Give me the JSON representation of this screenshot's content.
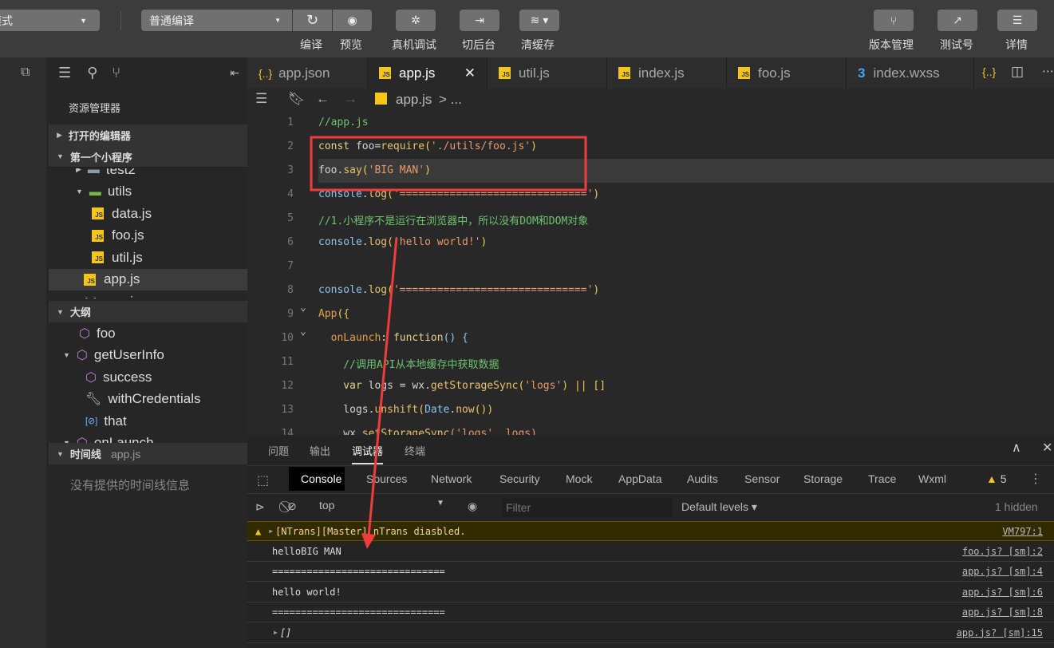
{
  "toolbar": {
    "mode_select": "模式",
    "compile_select": "普通编译",
    "buttons": {
      "compile": "编译",
      "preview": "预览",
      "remote_debug": "真机调试",
      "background": "切后台",
      "clear_cache": "清缓存",
      "version": "版本管理",
      "test_account": "测试号",
      "details": "详情"
    }
  },
  "explorer": {
    "title": "资源管理器",
    "open_editors": "打开的编辑器",
    "project": "第一个小程序",
    "files": [
      {
        "name": "test2",
        "icon": "folder",
        "indent": 1
      },
      {
        "name": "utils",
        "icon": "folder-green",
        "indent": 1
      },
      {
        "name": "data.js",
        "icon": "js",
        "indent": 2
      },
      {
        "name": "foo.js",
        "icon": "js",
        "indent": 2
      },
      {
        "name": "util.js",
        "icon": "js",
        "indent": 2
      },
      {
        "name": "app.js",
        "icon": "js",
        "indent": 1,
        "selected": true
      },
      {
        "name": "app.json",
        "icon": "json",
        "indent": 1
      }
    ],
    "outline_title": "大纲",
    "outline": [
      {
        "name": "foo",
        "icon": "cube-icon",
        "indent": 0
      },
      {
        "name": "getUserInfo",
        "icon": "cube-icon",
        "indent": 0
      },
      {
        "name": "success",
        "icon": "cube-icon",
        "indent": 1
      },
      {
        "name": "withCredentials",
        "icon": "wrench-icon",
        "indent": 1
      },
      {
        "name": "that",
        "icon": "variable-icon",
        "indent": 1
      },
      {
        "name": "onLaunch",
        "icon": "cube-icon",
        "indent": 0
      }
    ],
    "timeline_title": "时间线",
    "timeline_file": "app.js",
    "timeline_empty": "没有提供的时间线信息"
  },
  "tabs": [
    {
      "label": "app.json",
      "icon": "json"
    },
    {
      "label": "app.js",
      "icon": "js",
      "active": true
    },
    {
      "label": "util.js",
      "icon": "js"
    },
    {
      "label": "index.js",
      "icon": "js"
    },
    {
      "label": "foo.js",
      "icon": "js"
    },
    {
      "label": "index.wxss",
      "icon": "css"
    }
  ],
  "breadcrumb": {
    "file": "app.js",
    "rest": "> ..."
  },
  "code": [
    [
      [
        "//app.js",
        "c"
      ]
    ],
    [
      [
        "const ",
        "k"
      ],
      [
        "foo",
        "v"
      ],
      [
        "=",
        "v"
      ],
      [
        "require",
        "f"
      ],
      [
        "(",
        "p"
      ],
      [
        "'./utils/foo.js'",
        "s"
      ],
      [
        ")",
        "p"
      ]
    ],
    [
      [
        "foo",
        "v"
      ],
      [
        ".",
        "v"
      ],
      [
        "say",
        "f"
      ],
      [
        "(",
        "p"
      ],
      [
        "'BIG MAN'",
        "s"
      ],
      [
        ")",
        "p"
      ]
    ],
    [
      [
        "console",
        "b"
      ],
      [
        ".",
        "v"
      ],
      [
        "log",
        "f"
      ],
      [
        "(",
        "p"
      ],
      [
        "'=============================='",
        "s"
      ],
      [
        ")",
        "p"
      ]
    ],
    [
      [
        "//1.小程序不是运行在浏览器中，所以没有DOM和DOM对象",
        "c"
      ]
    ],
    [
      [
        "console",
        "b"
      ],
      [
        ".",
        "v"
      ],
      [
        "log",
        "f"
      ],
      [
        "(",
        "p"
      ],
      [
        "'hello world!'",
        "s"
      ],
      [
        ")",
        "p"
      ]
    ],
    [],
    [
      [
        "console",
        "b"
      ],
      [
        ".",
        "v"
      ],
      [
        "log",
        "f"
      ],
      [
        "(",
        "p"
      ],
      [
        "'=============================='",
        "s"
      ],
      [
        ")",
        "p"
      ]
    ],
    [
      [
        "App",
        "o"
      ],
      [
        "({",
        "p"
      ]
    ],
    [
      [
        "  onLaunch",
        "o"
      ],
      [
        ": ",
        "v"
      ],
      [
        "function",
        "k"
      ],
      [
        "() {",
        "b"
      ]
    ],
    [
      [
        "    //调用API从本地缓存中获取数据",
        "c"
      ]
    ],
    [
      [
        "    var ",
        "k"
      ],
      [
        "logs = ",
        "v"
      ],
      [
        "wx",
        "v"
      ],
      [
        ".",
        "v"
      ],
      [
        "getStorageSync",
        "f"
      ],
      [
        "(",
        "p"
      ],
      [
        "'logs'",
        "s"
      ],
      [
        ") ",
        "p"
      ],
      [
        "|| []",
        "p"
      ]
    ],
    [
      [
        "    logs",
        "v"
      ],
      [
        ".",
        "v"
      ],
      [
        "unshift",
        "f"
      ],
      [
        "(",
        "p"
      ],
      [
        "Date",
        "b"
      ],
      [
        ".",
        "v"
      ],
      [
        "now",
        "f"
      ],
      [
        "())",
        "p"
      ]
    ],
    [
      [
        "    wx",
        "v"
      ],
      [
        ".",
        "v"
      ],
      [
        "setStorageSync",
        "f"
      ],
      [
        "('logs', logs)",
        "s"
      ]
    ]
  ],
  "panel": {
    "tabs": [
      "问题",
      "输出",
      "调试器",
      "终端"
    ],
    "active_tab": "调试器",
    "devtools_tabs": [
      "Console",
      "Sources",
      "Network",
      "Security",
      "Mock",
      "AppData",
      "Audits",
      "Sensor",
      "Storage",
      "Trace",
      "Wxml"
    ],
    "warning_count": "5",
    "context": "top",
    "filter_placeholder": "Filter",
    "levels": "Default levels",
    "hidden": "1 hidden",
    "logs": [
      {
        "text": "[NTrans][Master] nTrans diasbled.",
        "source": "VM797:1",
        "level": "warning"
      },
      {
        "text": "helloBIG MAN",
        "source": "foo.js? [sm]:2"
      },
      {
        "text": "==============================",
        "source": "app.js? [sm]:4"
      },
      {
        "text": "hello world!",
        "source": "app.js? [sm]:6"
      },
      {
        "text": "==============================",
        "source": "app.js? [sm]:8"
      },
      {
        "text": "[]",
        "source": "app.js? [sm]:15",
        "expandable": true
      }
    ]
  },
  "colors": {
    "annotation": "#f03c3c",
    "accent_js": "#f5c518",
    "warning_bg": "#332b00"
  }
}
